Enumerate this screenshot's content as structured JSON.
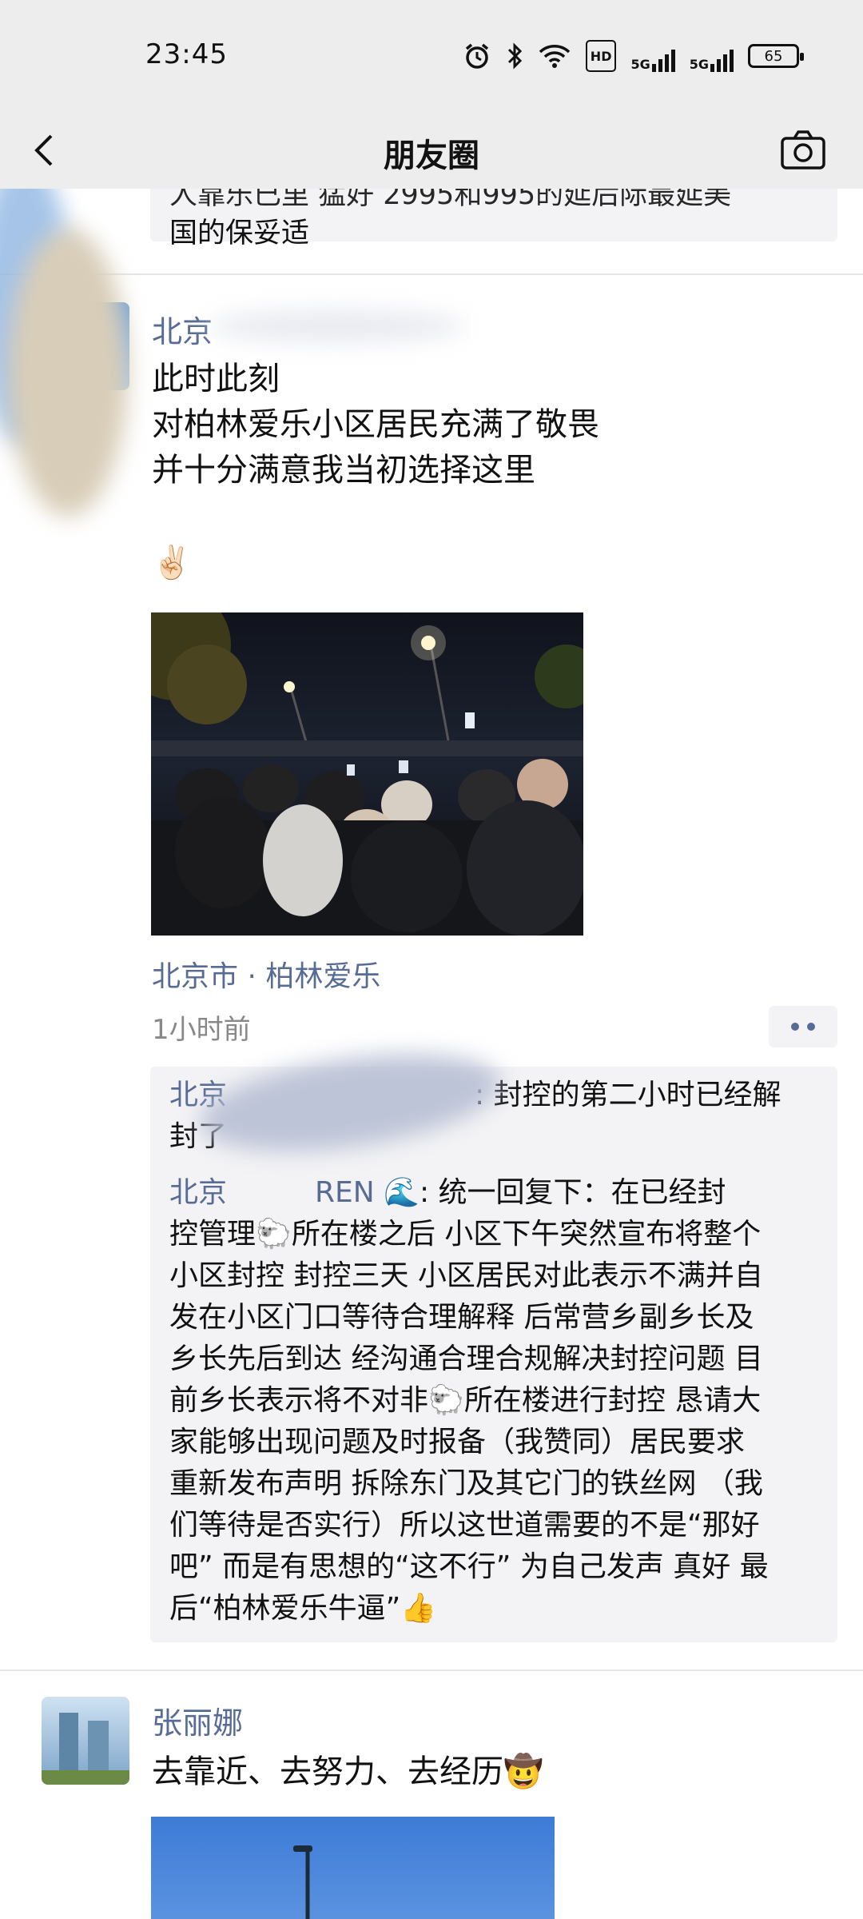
{
  "status_bar": {
    "time": "23:45",
    "network_label": "5G",
    "hd_label": "HD",
    "battery": "65"
  },
  "nav": {
    "title": "朋友圈"
  },
  "prev_comment": {
    "line_cut": "人靠乐已里 猛好 2995和995的延后际最延美",
    "line": "国的保妥适"
  },
  "post1": {
    "author": "北京",
    "text_lines": [
      "此时此刻",
      "对柏林爱乐小区居民充满了敬畏",
      "并十分满意我当初选择这里"
    ],
    "emoji": "✌🏻",
    "location": "北京市 · 柏林爱乐",
    "time": "1小时前",
    "comments": [
      {
        "name": "北京",
        "lines": [
          ": 封控的第二小时已经解",
          "封了"
        ]
      },
      {
        "name": "北京",
        "name_tail": "REN 🌊",
        "lines": [
          ": 统一回复下：在已经封",
          "控管理🐑所在楼之后 小区下午突然宣布将整个",
          "小区封控 封控三天 小区居民对此表示不满并自",
          "发在小区门口等待合理解释 后常营乡副乡长及",
          "乡长先后到达 经沟通合理合规解决封控问题 目",
          "前乡长表示将不对非🐑所在楼进行封控 恳请大",
          "家能够出现问题及时报备（我赞同）居民要求",
          "重新发布声明 拆除东门及其它门的铁丝网 （我",
          "们等待是否实行）所以这世道需要的不是“那好",
          "吧” 而是有思想的“这不行” 为自己发声 真好 最",
          "后“柏林爱乐牛逼”👍"
        ]
      }
    ]
  },
  "post2": {
    "author": "张丽娜",
    "text": "去靠近、去努力、去经历🤠"
  },
  "colors": {
    "link_blue": "#576b95",
    "bar_bg": "#ededed",
    "comment_bg": "#f3f3f5"
  },
  "icons": [
    "back-arrow-icon",
    "camera-icon",
    "alarm-icon",
    "bluetooth-icon",
    "wifi-icon",
    "signal-icon",
    "battery-icon",
    "more-dots-icon"
  ]
}
